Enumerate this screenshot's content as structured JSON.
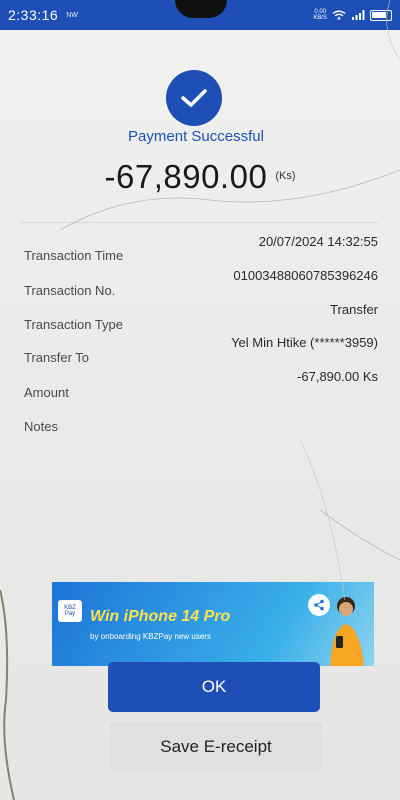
{
  "status_bar": {
    "time": "2:33:16",
    "notif": "NW",
    "net_speed_top": "0.00",
    "net_speed_bottom": "KB/S"
  },
  "colors": {
    "brand_blue": "#1e4fb6",
    "banner_yellow": "#ffe34d"
  },
  "header": {
    "icon": "checkmark-icon",
    "title": "Payment Successful",
    "amount": "-67,890.00",
    "currency": "(Ks)"
  },
  "details": [
    {
      "label": "Transaction Time",
      "value": "20/07/2024 14:32:55"
    },
    {
      "label": "Transaction No.",
      "value": "01003488060785396246"
    },
    {
      "label": "Transaction Type",
      "value": "Transfer"
    },
    {
      "label": "Transfer To",
      "value": "Yel Min Htike (******3959)"
    },
    {
      "label": "Amount",
      "value": "-67,890.00 Ks"
    },
    {
      "label": "Notes",
      "value": ""
    }
  ],
  "banner": {
    "logo_top": "KBZ",
    "logo_bottom": "Pay",
    "title": "Win iPhone 14 Pro",
    "subtitle": "by onboarding KBZPay new users"
  },
  "buttons": {
    "ok": "OK",
    "save_receipt": "Save E-receipt"
  }
}
